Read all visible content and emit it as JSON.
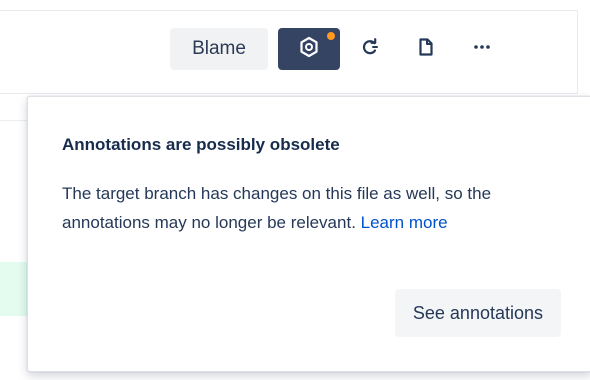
{
  "toolbar": {
    "blame_label": "Blame",
    "buttons": {
      "annotations_icon": "annotations-target-icon",
      "refresh_icon": "refresh-icon",
      "file_icon": "file-icon",
      "more_icon": "more-icon"
    },
    "more_label": "···"
  },
  "colors": {
    "active_button_bg": "#354463",
    "notification_dot": "#ff991f",
    "link": "#0052cc",
    "added_line_bg": "#e3fcef"
  },
  "popover": {
    "title": "Annotations are possibly obsolete",
    "body_text": "The target branch has changes on this file as well, so the annotations may no longer be relevant.",
    "learn_more_label": "Learn more",
    "action_label": "See annotations"
  }
}
